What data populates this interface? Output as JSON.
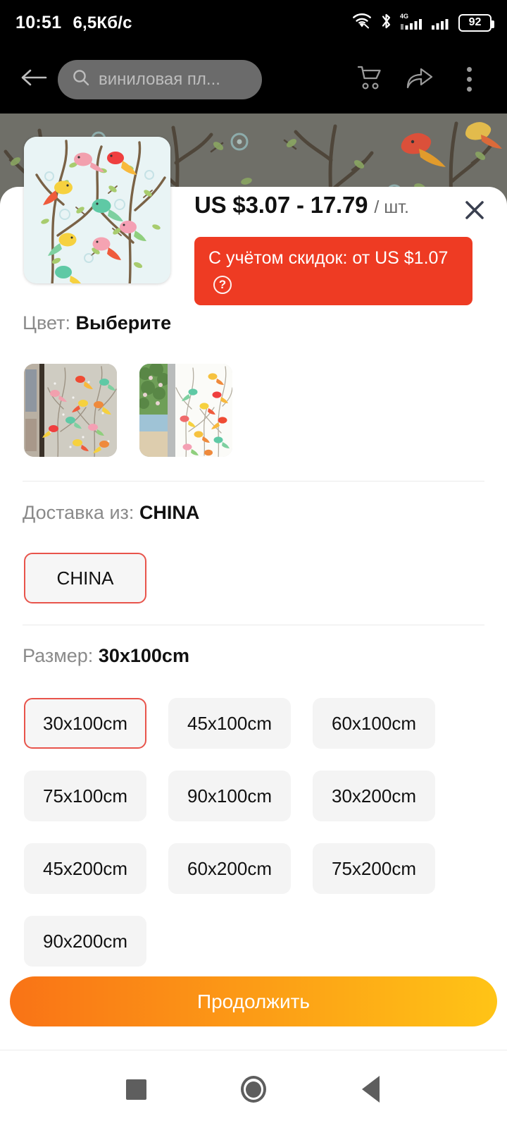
{
  "status_bar": {
    "time": "10:51",
    "network_speed": "6,5Кб/c",
    "battery_level": "92",
    "icons": [
      "wifi-icon",
      "bluetooth-icon",
      "signal-4g-icon",
      "signal-icon",
      "battery-icon"
    ]
  },
  "toolbar": {
    "back_icon": "arrow-left-icon",
    "search_query": "виниловая пл...",
    "search_icon": "search-icon",
    "cart_icon": "cart-icon",
    "share_icon": "share-icon",
    "more_icon": "more-vertical-icon"
  },
  "sheet": {
    "price": "US $3.07 - 17.79",
    "price_unit": "/ шт.",
    "close_icon": "close-icon",
    "discount_text": "С учётом скидок: от US $1.07",
    "discount_help_icon": "question-mark-icon",
    "discount_bg": "#ee3b23"
  },
  "color_section": {
    "label": "Цвет:",
    "value": "Выберите",
    "options": [
      {
        "name": "window-film-grey-room"
      },
      {
        "name": "window-film-white-garden"
      }
    ]
  },
  "shipping_section": {
    "label": "Доставка из:",
    "value": "CHINA",
    "options": [
      {
        "label": "CHINA",
        "selected": true
      }
    ]
  },
  "size_section": {
    "label": "Размер:",
    "value": "30x100cm",
    "options": [
      {
        "label": "30x100cm",
        "selected": true
      },
      {
        "label": "45x100cm",
        "selected": false
      },
      {
        "label": "60x100cm",
        "selected": false
      },
      {
        "label": "75x100cm",
        "selected": false
      },
      {
        "label": "90x100cm",
        "selected": false
      },
      {
        "label": "30x200cm",
        "selected": false
      },
      {
        "label": "45x200cm",
        "selected": false
      },
      {
        "label": "60x200cm",
        "selected": false
      },
      {
        "label": "75x200cm",
        "selected": false
      },
      {
        "label": "90x200cm",
        "selected": false
      }
    ]
  },
  "cta": {
    "label": "Продолжить",
    "gradient_from": "#f97316",
    "gradient_to": "#ffc416"
  },
  "nav_bar": {
    "recents_icon": "square-icon",
    "home_icon": "circle-icon",
    "back_icon": "triangle-back-icon"
  },
  "theme": {
    "accent_red": "#e8544b",
    "chip_bg": "#f4f4f4",
    "muted_text": "#8a8a8a"
  }
}
